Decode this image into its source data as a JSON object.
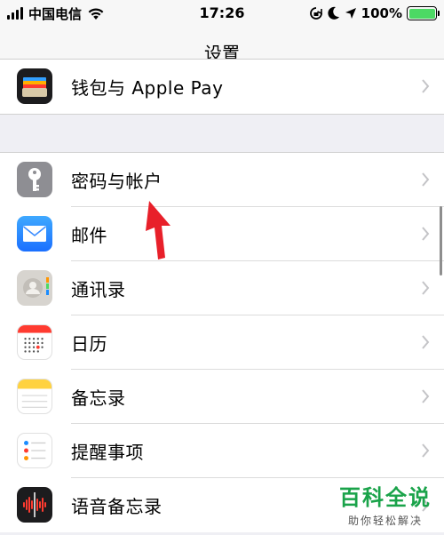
{
  "status_bar": {
    "carrier": "中国电信",
    "time": "17:26",
    "battery": "100%",
    "icons": [
      "signal-bars-icon",
      "wifi-icon",
      "rotation-lock-icon",
      "moon-icon",
      "location-arrow-icon",
      "battery-icon"
    ]
  },
  "nav": {
    "title": "设置"
  },
  "rows": [
    {
      "label": "钱包与 Apple Pay",
      "icon": "wallet-icon"
    },
    {
      "label": "密码与帐户",
      "icon": "key-icon"
    },
    {
      "label": "邮件",
      "icon": "mail-icon"
    },
    {
      "label": "通讯录",
      "icon": "contacts-icon"
    },
    {
      "label": "日历",
      "icon": "calendar-icon"
    },
    {
      "label": "备忘录",
      "icon": "notes-icon"
    },
    {
      "label": "提醒事项",
      "icon": "reminders-icon"
    },
    {
      "label": "语音备忘录",
      "icon": "voice-memos-icon"
    }
  ],
  "watermark": {
    "title": "百科全说",
    "subtitle": "助你轻松解决"
  },
  "colors": {
    "accent_green": "#1aa34a",
    "battery_green": "#4cd964",
    "arrow_red": "#e8202a",
    "mail_blue": "#1a8cff"
  }
}
